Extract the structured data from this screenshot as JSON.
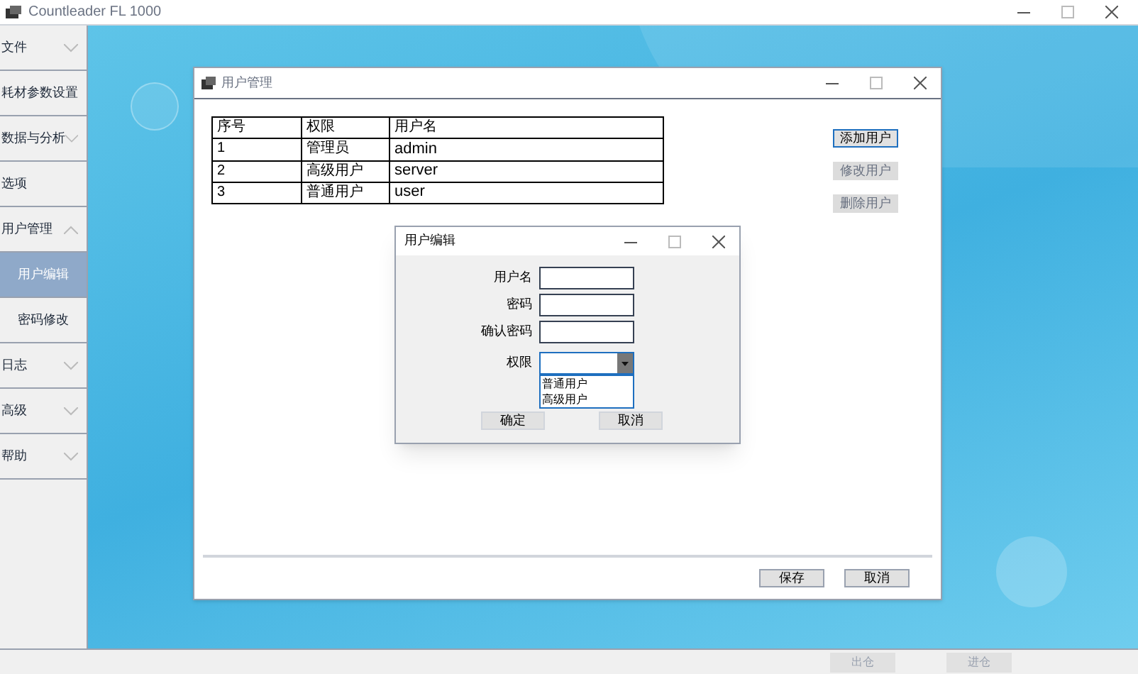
{
  "window": {
    "title": "Countleader FL 1000"
  },
  "sidebar": {
    "items": [
      {
        "label": "文件",
        "kind": "group",
        "expanded": false
      },
      {
        "label": "耗材参数设置",
        "kind": "plain"
      },
      {
        "label": "数据与分析",
        "kind": "group",
        "expanded": false
      },
      {
        "label": "选项",
        "kind": "plain"
      },
      {
        "label": "用户管理",
        "kind": "group",
        "expanded": true,
        "children": [
          {
            "label": "用户编辑",
            "selected": true
          },
          {
            "label": "密码修改",
            "selected": false
          }
        ]
      },
      {
        "label": "日志",
        "kind": "group",
        "expanded": false
      },
      {
        "label": "高级",
        "kind": "group",
        "expanded": false
      },
      {
        "label": "帮助",
        "kind": "group",
        "expanded": false
      }
    ]
  },
  "user_window": {
    "title": "用户管理",
    "table": {
      "columns": [
        "序号",
        "权限",
        "用户名"
      ],
      "rows": [
        [
          "1",
          "管理员",
          "admin"
        ],
        [
          "2",
          "高级用户",
          "server"
        ],
        [
          "3",
          "普通用户",
          "user"
        ]
      ]
    },
    "side_buttons": [
      {
        "label": "添加用户",
        "disabled": false
      },
      {
        "label": "修改用户",
        "disabled": true
      },
      {
        "label": "删除用户",
        "disabled": true
      }
    ],
    "footer_buttons": [
      {
        "label": "保存"
      },
      {
        "label": "取消"
      }
    ]
  },
  "edit_dialog": {
    "title": "用户编辑",
    "fields": [
      {
        "label": "用户名",
        "kind": "text"
      },
      {
        "label": "密码",
        "kind": "text"
      },
      {
        "label": "确认密码",
        "kind": "text"
      },
      {
        "label": "权限",
        "kind": "combo",
        "options": [
          "普通用户",
          "高级用户"
        ]
      }
    ],
    "buttons": [
      {
        "label": "确定"
      },
      {
        "label": "取消"
      }
    ]
  },
  "status_bar": {
    "buttons": [
      {
        "label": "出仓",
        "disabled": true
      },
      {
        "label": "进仓",
        "disabled": true
      }
    ]
  }
}
